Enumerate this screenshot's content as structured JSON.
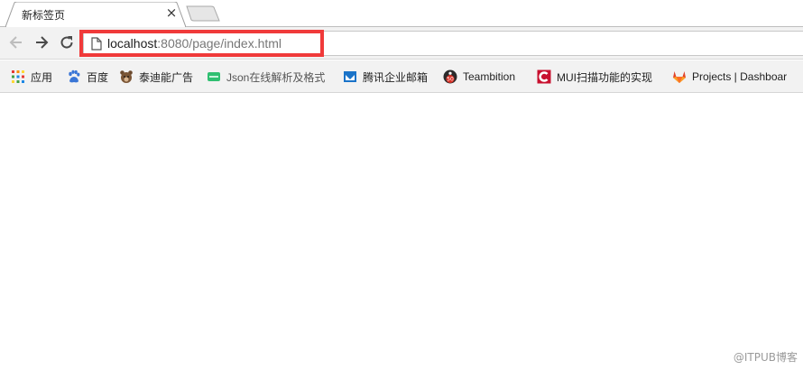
{
  "tab": {
    "title": "新标签页",
    "close_glyph": "×"
  },
  "address": {
    "host": "localhost",
    "rest": ":8080/page/index.html"
  },
  "highlight_color": "#f03a3a",
  "bookmarks": [
    {
      "label": "应用",
      "icon": "apps-grid-icon"
    },
    {
      "label": "百度",
      "icon": "baidu-paw-icon"
    },
    {
      "label": "泰迪能广告",
      "icon": "bear-icon"
    },
    {
      "label": "Json在线解析及格式",
      "icon": "json-icon"
    },
    {
      "label": "腾讯企业邮箱",
      "icon": "tencent-mail-icon"
    },
    {
      "label": "Teambition",
      "icon": "teambition-icon"
    },
    {
      "label": "MUI扫描功能的实现",
      "icon": "c-logo-icon"
    },
    {
      "label": "Projects | Dashboar",
      "icon": "gitlab-fox-icon"
    }
  ],
  "watermark": "@ITPUB博客"
}
